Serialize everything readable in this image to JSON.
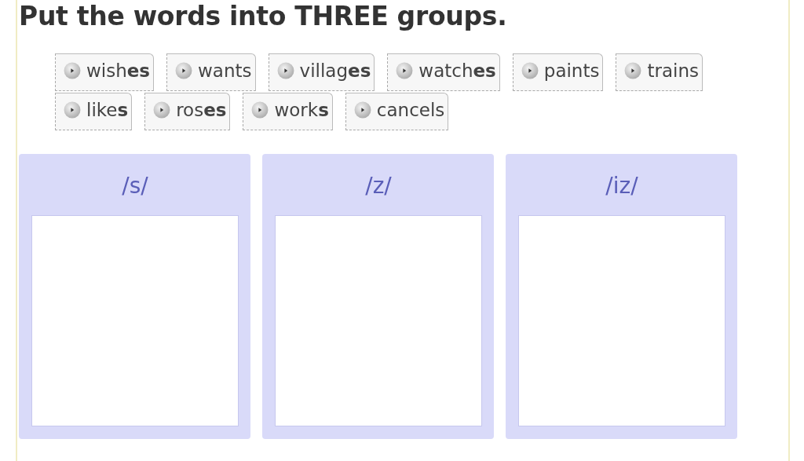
{
  "instruction": "Put the words into THREE groups.",
  "words": [
    {
      "text": "wish**es**"
    },
    {
      "text": "wants"
    },
    {
      "text": "villag**es**"
    },
    {
      "text": "watch**es**"
    },
    {
      "text": "paints"
    },
    {
      "text": "trains"
    },
    {
      "text": "like**s**"
    },
    {
      "text": "ros**es**"
    },
    {
      "text": "work**s**"
    },
    {
      "text": "cancels"
    }
  ],
  "groups": [
    {
      "heading": "/s/"
    },
    {
      "heading": "/z/"
    },
    {
      "heading": "/iz/"
    }
  ]
}
